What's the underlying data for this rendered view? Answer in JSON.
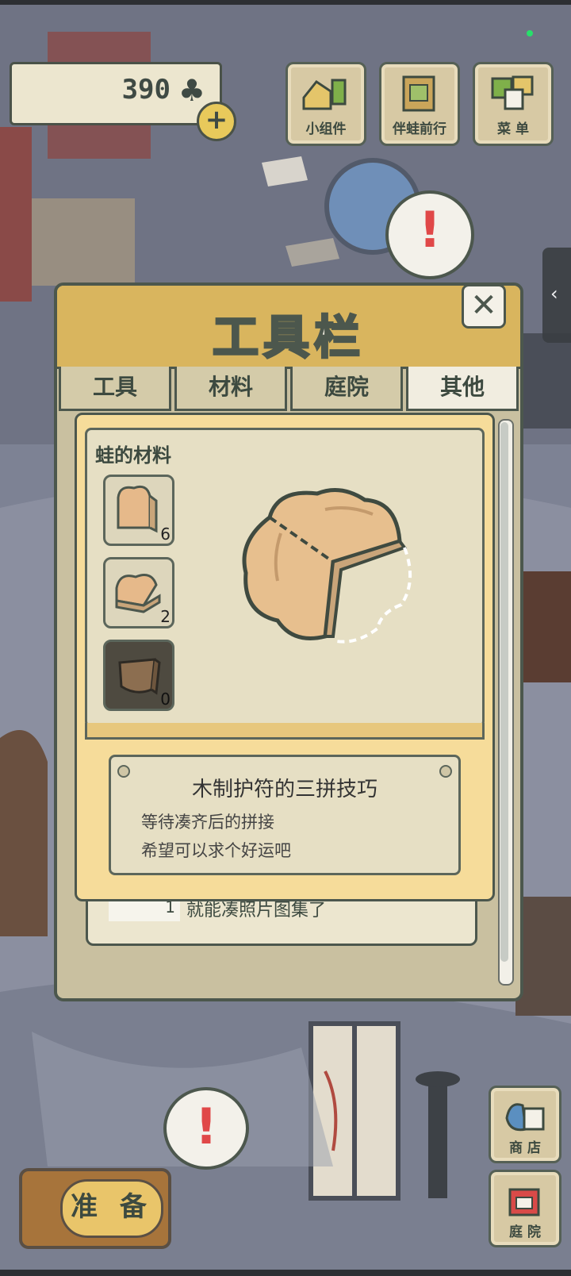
{
  "hud": {
    "coins": "390",
    "coin_icon": "clover-icon",
    "add_label": "+"
  },
  "top_buttons": [
    {
      "label": "小组件",
      "icon": "widget-icon"
    },
    {
      "label": "伴蛙前行",
      "icon": "journey-icon"
    },
    {
      "label": "菜 单",
      "icon": "menu-icon"
    }
  ],
  "alert": "!",
  "panel": {
    "title": "工具栏",
    "close": "✕",
    "tabs": [
      "工具",
      "材料",
      "庭院",
      "其他"
    ],
    "active_tab": "其他",
    "section_label": "蛙的材料",
    "slots": [
      {
        "count": "6",
        "state": "owned"
      },
      {
        "count": "2",
        "state": "owned"
      },
      {
        "count": "0",
        "state": "empty"
      }
    ],
    "item_title": "木制护符的三拼技巧",
    "item_lines": [
      "等待凑齐后的拼接",
      "希望可以求个好运吧"
    ],
    "behind_count": "1",
    "behind_text": "就能凑照片图集了"
  },
  "bottom": {
    "prepare": "准 备",
    "shop": "商 店",
    "yard": "庭 院"
  },
  "colors": {
    "accent": "#d9b55e",
    "alert": "#e04848",
    "card": "#f6dc9a"
  }
}
